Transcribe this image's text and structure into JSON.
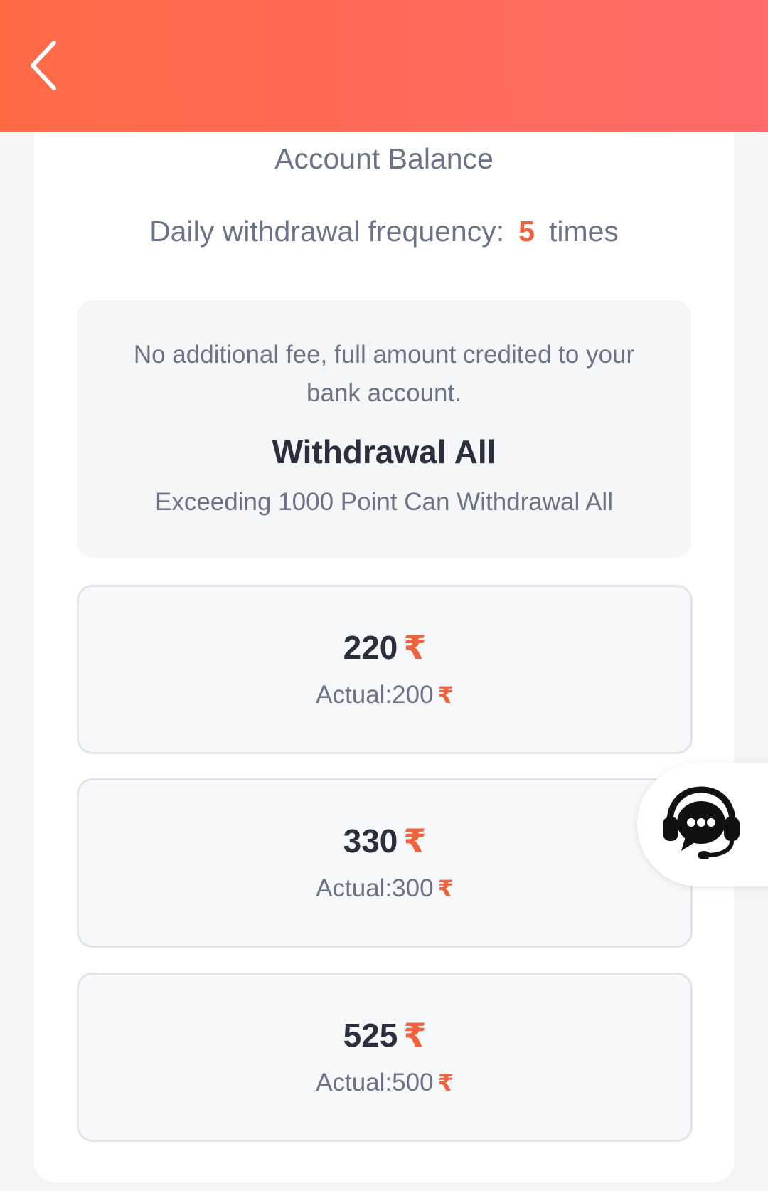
{
  "header": {
    "back_icon": "chevron-left-icon",
    "gradient_colors": [
      "#ff6a45",
      "#ff6a6a"
    ]
  },
  "balance": {
    "title": "Account Balance"
  },
  "frequency": {
    "label": "Daily withdrawal frequency:",
    "count": "5",
    "unit": "times"
  },
  "info": {
    "fee_text": "No additional fee, full amount credited to your bank account.",
    "withdraw_all_title": "Withdrawal All",
    "withdraw_all_subtitle": "Exceeding 1000 Point Can Withdrawal All"
  },
  "currency_symbol": "₹",
  "options": [
    {
      "amount": "220",
      "actual": "Actual:200"
    },
    {
      "amount": "330",
      "actual": "Actual:300"
    },
    {
      "amount": "525",
      "actual": "Actual:500"
    }
  ],
  "support": {
    "icon": "customer-support-headset-icon"
  },
  "colors": {
    "accent": "#f0623e",
    "text_primary": "#2a2f3d",
    "text_secondary": "#6b7387"
  }
}
